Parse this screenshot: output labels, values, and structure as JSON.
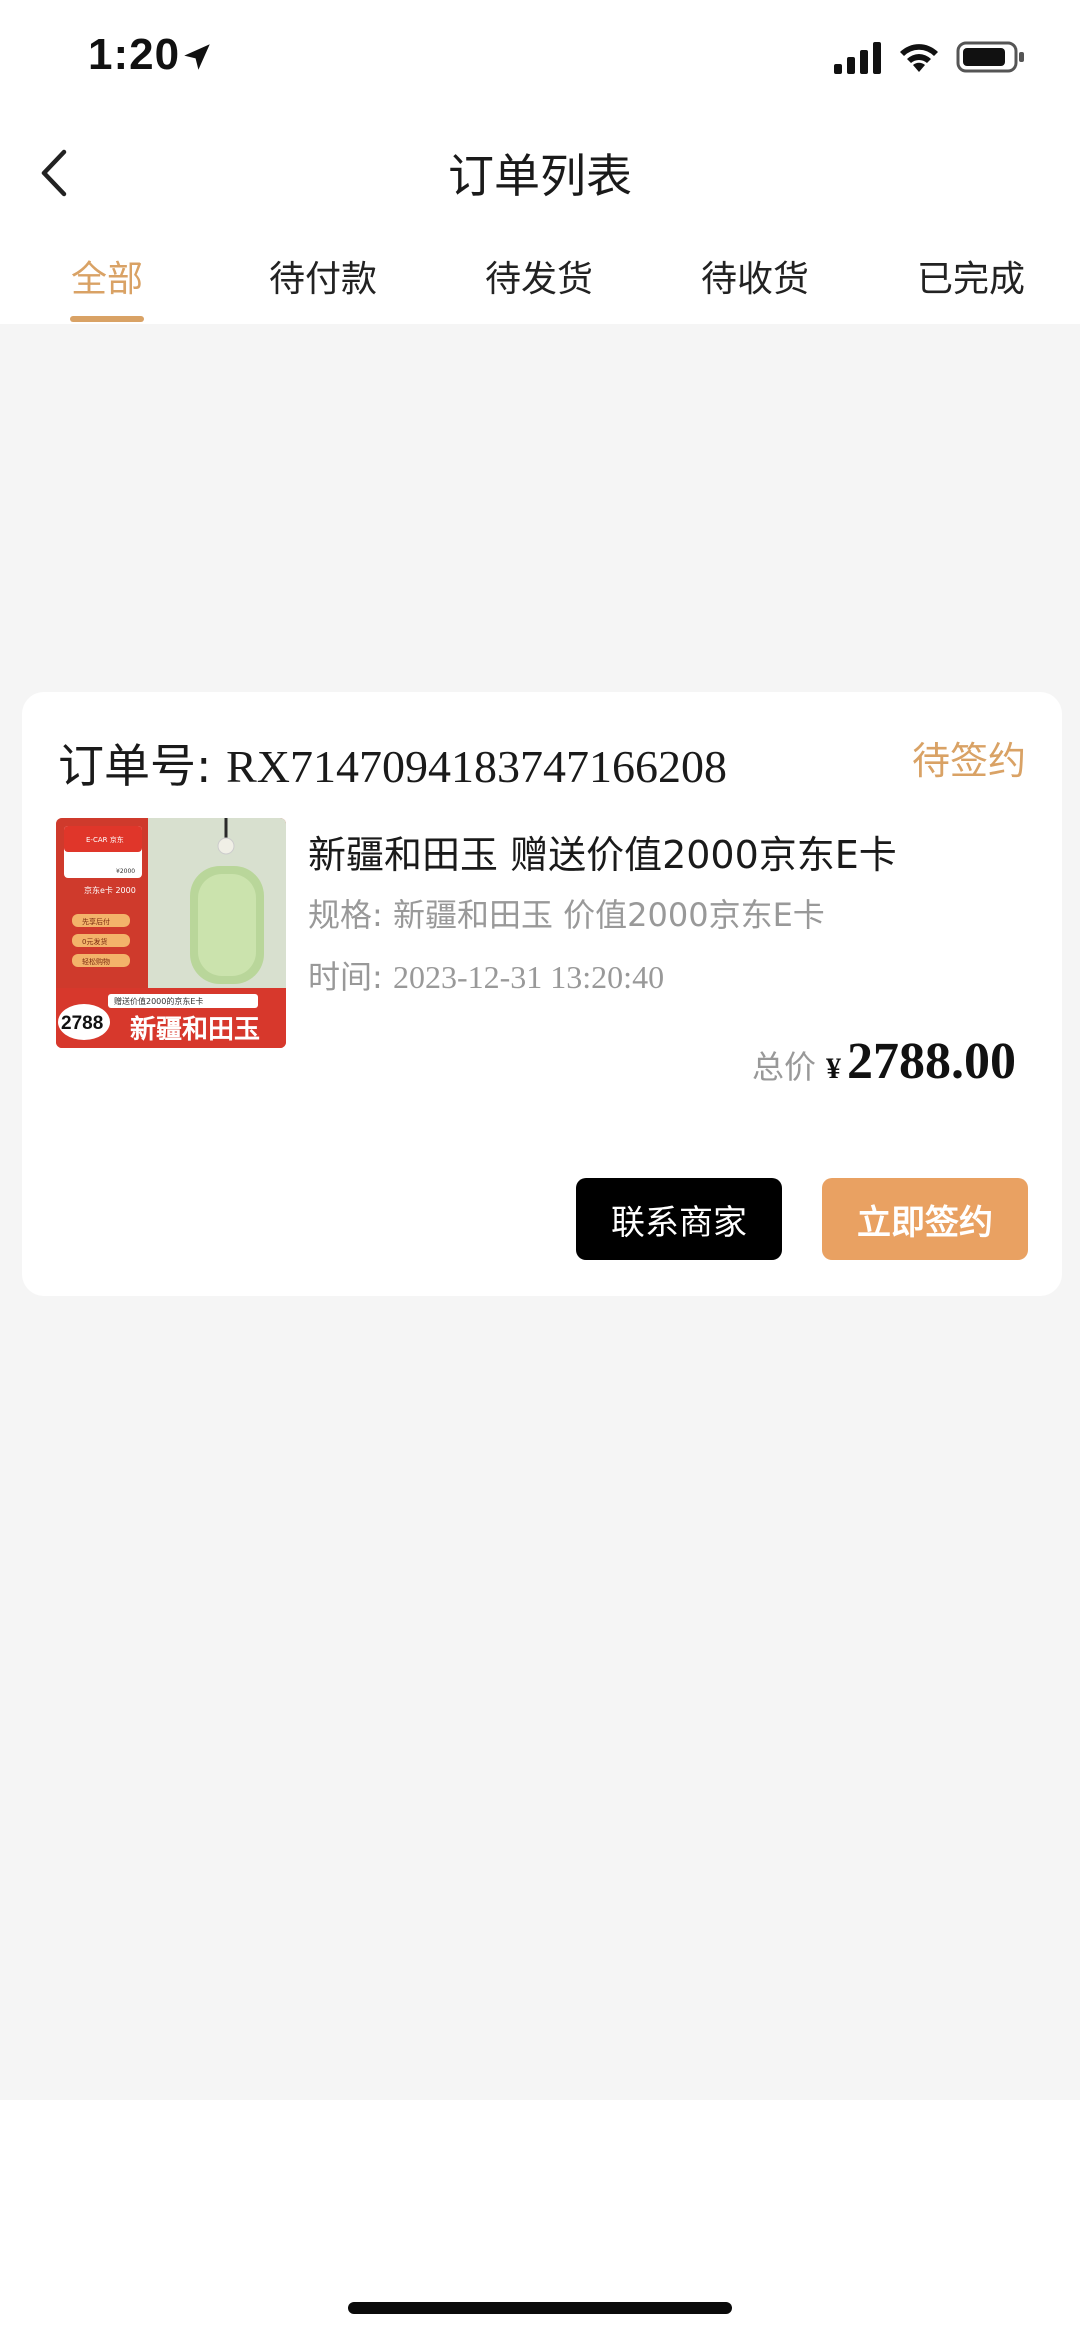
{
  "status_bar": {
    "time": "1:20",
    "icons": [
      "location-arrow-icon",
      "cellular-signal-icon",
      "wifi-icon",
      "battery-icon"
    ]
  },
  "header": {
    "title": "订单列表",
    "back_icon": "chevron-left-icon"
  },
  "tabs": [
    {
      "label": "全部",
      "active": true
    },
    {
      "label": "待付款",
      "active": false
    },
    {
      "label": "待发货",
      "active": false
    },
    {
      "label": "待收货",
      "active": false
    },
    {
      "label": "已完成",
      "active": false
    }
  ],
  "order": {
    "order_no_label": "订单号: ",
    "order_no": "RX7147094183747166208",
    "status": "待签约",
    "product": {
      "title": "新疆和田玉 赠送价值2000京东E卡",
      "spec_label": "规格: ",
      "spec_value": "新疆和田玉 价值2000京东E卡",
      "time_label": "时间: ",
      "time_value": "2023-12-31 13:20:40",
      "thumb": {
        "card_brand": "E-CAR 京东",
        "card_value": "¥2000",
        "card_name": "京东e卡 2000",
        "pill_1": "先享后付",
        "pill_2": "0元发货",
        "pill_3": "轻松购物",
        "banner_small": "赠送价值2000的京东E卡",
        "banner_price": "2788",
        "banner_big": "新疆和田玉"
      }
    },
    "total_label": "总价",
    "currency": "¥",
    "total": "2788.00",
    "buttons": {
      "contact": "联系商家",
      "sign": "立即签约"
    }
  },
  "colors": {
    "accent": "#d9a265",
    "sign_button": "#e9a162",
    "contact_button": "#000000",
    "page_bg": "#f5f5f5"
  }
}
